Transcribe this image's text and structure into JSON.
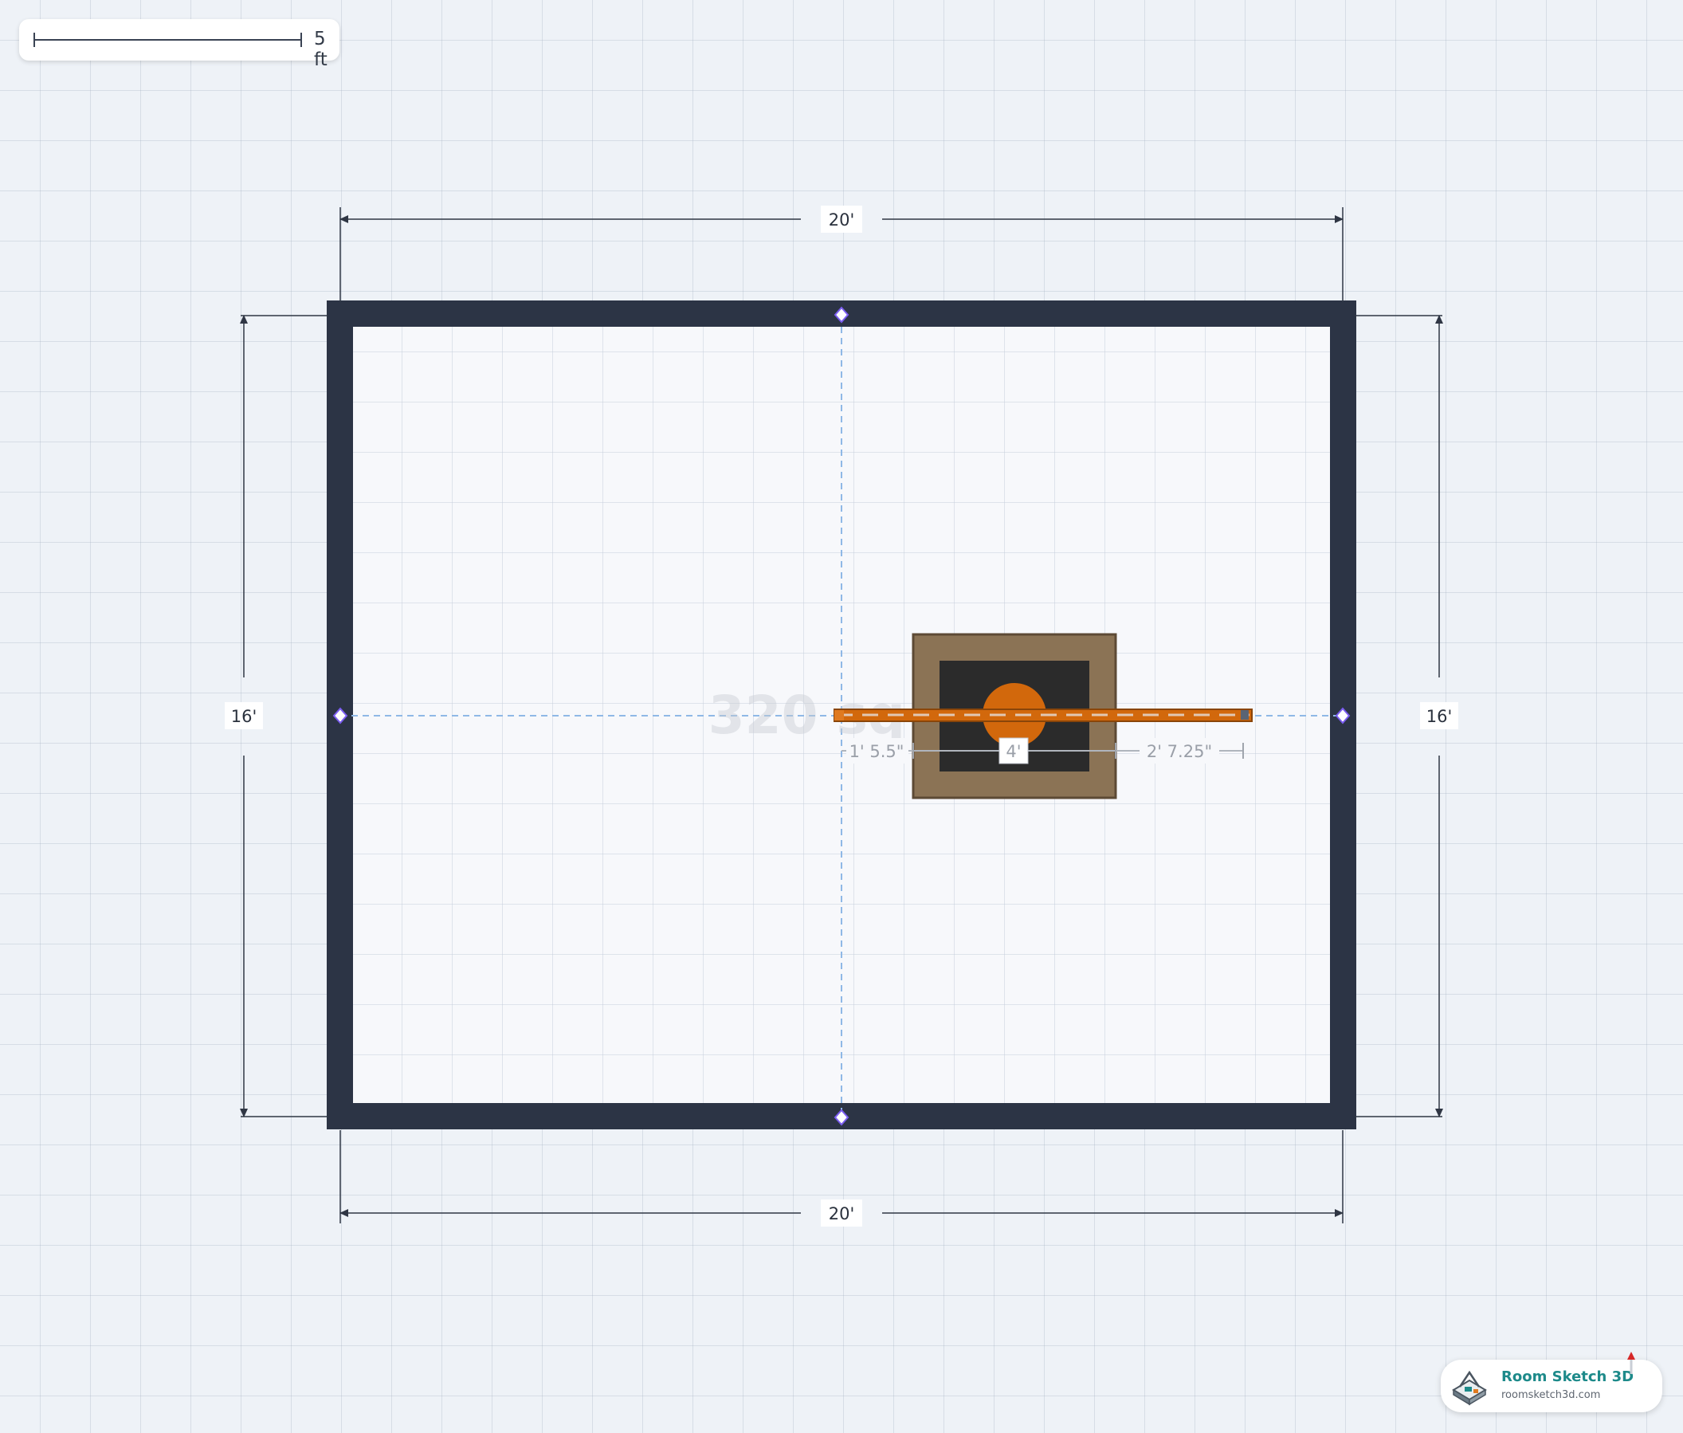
{
  "scale_bar": {
    "label": "5 ft"
  },
  "room": {
    "area_label": "320 sq ft",
    "width_label_top": "20'",
    "width_label_bottom": "20'",
    "height_label_left": "16'",
    "height_label_right": "16'"
  },
  "fixture": {
    "left_offset_label": "1' 5.5\"",
    "width_label": "4'",
    "right_offset_label": "2' 7.25\""
  },
  "brand": {
    "name": "Room Sketch 3D",
    "url": "roomsketch3d.com"
  },
  "colors": {
    "wall": "#2c3445",
    "floor": "#f7f8fb",
    "grid": "#c6cedb",
    "fixture_outer": "#8b7355",
    "fixture_inner": "#2b2b2b",
    "accent_orange": "#d2680c",
    "guide_blue": "#8fb8e6",
    "handle_purple": "#7a5cf0",
    "brand_teal": "#1d8a8a"
  },
  "icons": [
    "ruler-scale-icon",
    "room-sketch-logo-icon",
    "flag-marker-icon",
    "wall-handle-icon"
  ]
}
